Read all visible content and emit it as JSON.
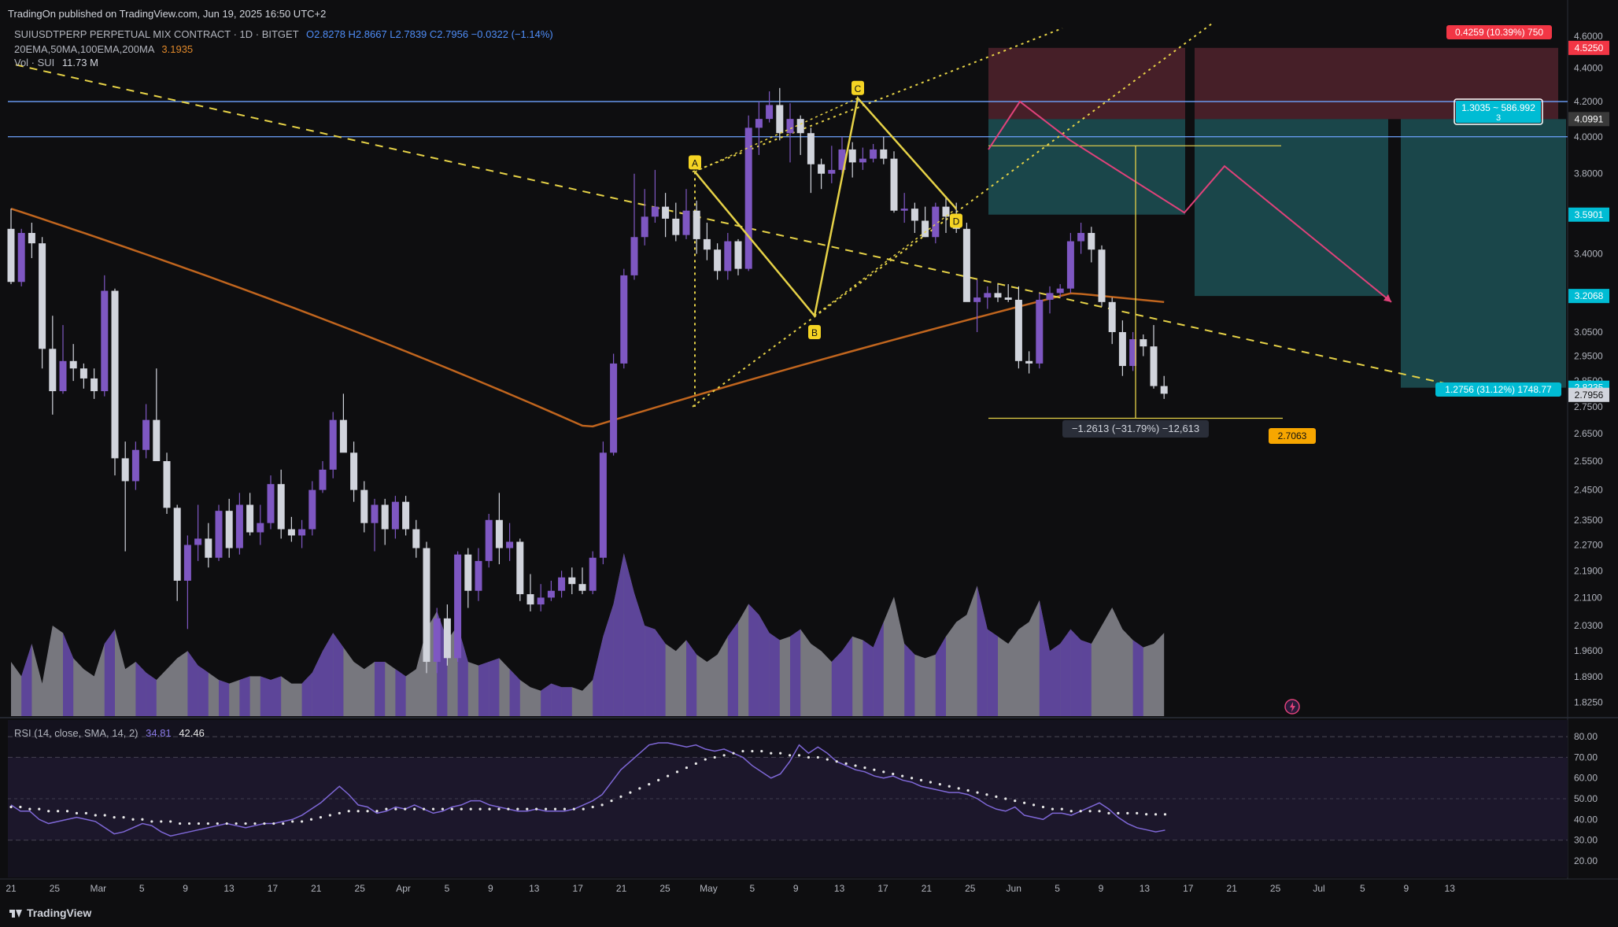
{
  "publish_line": "TradingOn published on TradingView.com, Jun 19, 2025 16:50 UTC+2",
  "legend": {
    "symbol": "SUIUSDTPERP PERPETUAL MIX CONTRACT · 1D · BITGET",
    "ohlc": "O2.8278 H2.8667 L2.7839 C2.7956 −0.0322 (−1.14%)",
    "ma_label": "20EMA,50MA,100EMA,200MA",
    "ma_value": "3.1935",
    "vol_label": "Vol · SUI",
    "vol_value": "11.73 M"
  },
  "rsi_legend": {
    "label": "RSI (14, close, SMA, 14, 2)",
    "value1": "34.81",
    "value2": "42.46"
  },
  "footer": {
    "brand": "TradingView"
  },
  "colors": {
    "bg": "#0e0e10",
    "bull": "#7e57c2",
    "bear": "#d1d4dc",
    "ma": "#c0651e",
    "rsi": "#7e67d6",
    "accent_blue": "#4f8df7"
  },
  "chart_data": {
    "type": "candlestick",
    "symbol": "SUIUSDTPERP",
    "timeframe": "1D",
    "price_scale": {
      "min": 1.75,
      "max": 4.6,
      "scale": "log",
      "ticks": [
        "4.6000",
        "4.4000",
        "4.2000",
        "4.0000",
        "3.8000",
        "3.6000",
        "3.4000",
        "3.2000",
        "3.0500",
        "2.9500",
        "2.8500",
        "2.7500",
        "2.6500",
        "2.5500",
        "2.4500",
        "2.3500",
        "2.2700",
        "2.1900",
        "2.1100",
        "2.0300",
        "1.9600",
        "1.8900",
        "1.8250"
      ]
    },
    "x_axis_labels": [
      "21",
      "25",
      "Mar",
      "5",
      "9",
      "13",
      "17",
      "21",
      "25",
      "Apr",
      "5",
      "9",
      "13",
      "17",
      "21",
      "25",
      "May",
      "5",
      "9",
      "13",
      "17",
      "21",
      "25",
      "Jun",
      "5",
      "9",
      "13",
      "17",
      "21",
      "25",
      "Jul",
      "5",
      "9",
      "13"
    ],
    "candles": [
      [
        3.52,
        3.62,
        3.26,
        3.27
      ],
      [
        3.27,
        3.52,
        3.25,
        3.5
      ],
      [
        3.5,
        3.55,
        3.38,
        3.45
      ],
      [
        3.45,
        3.48,
        2.9,
        2.98
      ],
      [
        2.98,
        3.12,
        2.72,
        2.81
      ],
      [
        2.81,
        3.08,
        2.8,
        2.93
      ],
      [
        2.93,
        3.0,
        2.85,
        2.9
      ],
      [
        2.9,
        2.92,
        2.82,
        2.86
      ],
      [
        2.86,
        2.9,
        2.78,
        2.81
      ],
      [
        2.81,
        3.3,
        2.79,
        3.23
      ],
      [
        3.23,
        3.24,
        2.5,
        2.56
      ],
      [
        2.56,
        2.62,
        2.25,
        2.48
      ],
      [
        2.48,
        2.62,
        2.45,
        2.59
      ],
      [
        2.59,
        2.76,
        2.56,
        2.7
      ],
      [
        2.7,
        2.9,
        2.58,
        2.55
      ],
      [
        2.55,
        2.58,
        2.37,
        2.39
      ],
      [
        2.39,
        2.4,
        2.1,
        2.16
      ],
      [
        2.16,
        2.3,
        2.02,
        2.27
      ],
      [
        2.27,
        2.4,
        2.22,
        2.29
      ],
      [
        2.29,
        2.34,
        2.2,
        2.23
      ],
      [
        2.23,
        2.4,
        2.22,
        2.38
      ],
      [
        2.38,
        2.42,
        2.23,
        2.26
      ],
      [
        2.26,
        2.44,
        2.24,
        2.4
      ],
      [
        2.4,
        2.44,
        2.3,
        2.31
      ],
      [
        2.31,
        2.4,
        2.27,
        2.34
      ],
      [
        2.34,
        2.5,
        2.32,
        2.47
      ],
      [
        2.47,
        2.52,
        2.29,
        2.32
      ],
      [
        2.32,
        2.36,
        2.28,
        2.3
      ],
      [
        2.3,
        2.35,
        2.26,
        2.32
      ],
      [
        2.32,
        2.48,
        2.3,
        2.45
      ],
      [
        2.45,
        2.55,
        2.44,
        2.52
      ],
      [
        2.52,
        2.73,
        2.49,
        2.7
      ],
      [
        2.7,
        2.8,
        2.62,
        2.58
      ],
      [
        2.58,
        2.62,
        2.41,
        2.45
      ],
      [
        2.45,
        2.48,
        2.31,
        2.34
      ],
      [
        2.34,
        2.42,
        2.25,
        2.4
      ],
      [
        2.4,
        2.42,
        2.27,
        2.32
      ],
      [
        2.32,
        2.43,
        2.29,
        2.41
      ],
      [
        2.41,
        2.43,
        2.3,
        2.32
      ],
      [
        2.32,
        2.35,
        2.23,
        2.26
      ],
      [
        2.26,
        2.28,
        1.9,
        1.93
      ],
      [
        1.93,
        2.08,
        1.9,
        2.05
      ],
      [
        2.05,
        2.09,
        1.92,
        1.94
      ],
      [
        1.94,
        2.25,
        1.93,
        2.24
      ],
      [
        2.24,
        2.26,
        2.08,
        2.13
      ],
      [
        2.13,
        2.26,
        2.1,
        2.22
      ],
      [
        2.22,
        2.37,
        2.2,
        2.35
      ],
      [
        2.35,
        2.44,
        2.21,
        2.26
      ],
      [
        2.26,
        2.34,
        2.22,
        2.28
      ],
      [
        2.28,
        2.29,
        2.1,
        2.12
      ],
      [
        2.12,
        2.18,
        2.07,
        2.09
      ],
      [
        2.09,
        2.15,
        2.07,
        2.11
      ],
      [
        2.11,
        2.16,
        2.1,
        2.13
      ],
      [
        2.13,
        2.19,
        2.11,
        2.17
      ],
      [
        2.17,
        2.2,
        2.12,
        2.15
      ],
      [
        2.15,
        2.2,
        2.12,
        2.13
      ],
      [
        2.13,
        2.25,
        2.12,
        2.23
      ],
      [
        2.23,
        2.62,
        2.21,
        2.58
      ],
      [
        2.58,
        2.96,
        2.57,
        2.92
      ],
      [
        2.92,
        3.33,
        2.9,
        3.3
      ],
      [
        3.3,
        3.8,
        3.28,
        3.48
      ],
      [
        3.48,
        3.72,
        3.44,
        3.58
      ],
      [
        3.58,
        3.82,
        3.55,
        3.63
      ],
      [
        3.63,
        3.7,
        3.48,
        3.57
      ],
      [
        3.57,
        3.65,
        3.46,
        3.49
      ],
      [
        3.49,
        3.72,
        3.47,
        3.61
      ],
      [
        3.61,
        3.66,
        3.4,
        3.47
      ],
      [
        3.47,
        3.55,
        3.37,
        3.42
      ],
      [
        3.42,
        3.45,
        3.28,
        3.32
      ],
      [
        3.32,
        3.5,
        3.28,
        3.46
      ],
      [
        3.46,
        3.47,
        3.3,
        3.33
      ],
      [
        3.33,
        4.12,
        3.32,
        4.05
      ],
      [
        4.05,
        4.2,
        3.9,
        4.1
      ],
      [
        4.1,
        4.26,
        4.08,
        4.18
      ],
      [
        4.18,
        4.28,
        3.98,
        4.02
      ],
      [
        4.02,
        4.19,
        3.86,
        4.1
      ],
      [
        4.1,
        4.12,
        3.9,
        4.02
      ],
      [
        4.02,
        4.05,
        3.7,
        3.85
      ],
      [
        3.85,
        3.88,
        3.72,
        3.8
      ],
      [
        3.8,
        3.95,
        3.75,
        3.82
      ],
      [
        3.82,
        4.0,
        3.8,
        3.93
      ],
      [
        3.93,
        3.97,
        3.78,
        3.86
      ],
      [
        3.86,
        3.94,
        3.82,
        3.88
      ],
      [
        3.88,
        3.96,
        3.86,
        3.93
      ],
      [
        3.93,
        4.0,
        3.85,
        3.88
      ],
      [
        3.88,
        3.92,
        3.6,
        3.61
      ],
      [
        3.61,
        3.7,
        3.55,
        3.62
      ],
      [
        3.62,
        3.65,
        3.5,
        3.56
      ],
      [
        3.56,
        3.63,
        3.48,
        3.48
      ],
      [
        3.48,
        3.65,
        3.45,
        3.63
      ],
      [
        3.63,
        3.68,
        3.5,
        3.58
      ],
      [
        3.58,
        3.65,
        3.5,
        3.52
      ],
      [
        3.52,
        3.55,
        3.2,
        3.18
      ],
      [
        3.18,
        3.28,
        3.05,
        3.2
      ],
      [
        3.2,
        3.25,
        3.15,
        3.22
      ],
      [
        3.22,
        3.26,
        3.18,
        3.2
      ],
      [
        3.2,
        3.26,
        3.18,
        3.19
      ],
      [
        3.19,
        3.25,
        2.9,
        2.93
      ],
      [
        2.93,
        2.97,
        2.88,
        2.92
      ],
      [
        2.92,
        3.22,
        2.9,
        3.19
      ],
      [
        3.19,
        3.25,
        3.13,
        3.22
      ],
      [
        3.22,
        3.26,
        3.2,
        3.24
      ],
      [
        3.24,
        3.5,
        3.22,
        3.46
      ],
      [
        3.46,
        3.55,
        3.4,
        3.5
      ],
      [
        3.5,
        3.53,
        3.36,
        3.42
      ],
      [
        3.42,
        3.44,
        3.16,
        3.18
      ],
      [
        3.18,
        3.2,
        3.0,
        3.05
      ],
      [
        3.05,
        3.1,
        2.87,
        2.91
      ],
      [
        2.91,
        3.05,
        2.89,
        3.02
      ],
      [
        3.02,
        3.04,
        2.95,
        2.99
      ],
      [
        2.99,
        3.08,
        2.82,
        2.83
      ],
      [
        2.83,
        2.87,
        2.78,
        2.8
      ]
    ],
    "volume_label": "Vol · SUI",
    "series": [
      {
        "name": "20EMA,50MA,100EMA,200MA",
        "type": "line",
        "last": 3.1935
      }
    ],
    "price_labels": [
      {
        "text": "4.5250",
        "color": "#f23645"
      },
      {
        "text": "4.0991",
        "color": "#3a3a3a"
      },
      {
        "text": "3.5901",
        "color": "#00bcd4"
      },
      {
        "text": "3.2068",
        "color": "#00bcd4"
      },
      {
        "text": "2.8235",
        "color": "#00bcd4"
      },
      {
        "text": "2.7956",
        "color": "#d1d4dc"
      }
    ],
    "annotations": [
      {
        "text": "0.4259 (10.39%) 750",
        "color": "#f23645"
      },
      {
        "text": "1.3035 ~ 586.992",
        "sub": "3",
        "color": "#00bcd4"
      },
      {
        "text": "1.2756 (31.12%) 1748.77",
        "color": "#00bcd4"
      },
      {
        "text": "−1.2613 (−31.79%) −12,613",
        "color": "#2a2e39"
      },
      {
        "text": "2.7063",
        "color": "#f7a600"
      }
    ],
    "pattern_points": [
      "A",
      "B",
      "C",
      "D"
    ],
    "rsi": {
      "label": "RSI (14, close, SMA, 14, 2)",
      "value": 34.81,
      "sma": 42.46,
      "range": [
        20,
        80
      ],
      "ticks": [
        "80.00",
        "70.00",
        "60.00",
        "50.00",
        "40.00",
        "30.00",
        "20.00"
      ],
      "values": [
        47,
        44,
        44,
        40,
        38,
        39,
        40,
        41,
        40,
        39,
        36,
        33,
        34,
        36,
        38,
        37,
        34,
        32,
        33,
        34,
        35,
        36,
        37,
        38,
        37,
        36,
        37,
        38,
        38,
        39,
        40,
        42,
        45,
        48,
        52,
        56,
        52,
        47,
        46,
        43,
        44,
        46,
        45,
        47,
        45,
        43,
        44,
        46,
        47,
        49,
        49,
        47,
        46,
        45,
        44,
        44,
        45,
        44,
        44,
        44,
        45,
        47,
        49,
        52,
        58,
        64,
        68,
        72,
        76,
        77,
        77,
        76,
        75,
        76,
        74,
        73,
        74,
        72,
        70,
        66,
        63,
        60,
        62,
        68,
        76,
        72,
        75,
        72,
        68,
        66,
        64,
        63,
        61,
        60,
        61,
        59,
        58,
        56,
        55,
        54,
        53,
        53,
        52,
        50,
        47,
        45,
        44,
        46,
        42,
        41,
        40,
        43,
        43,
        42,
        44,
        46,
        48,
        45,
        41,
        38,
        36,
        35,
        34,
        34.81
      ],
      "sma_values": [
        46,
        46,
        45,
        45,
        44,
        44,
        44,
        43,
        43,
        42,
        42,
        41,
        41,
        40,
        40,
        39,
        39,
        39,
        38,
        38,
        38,
        38,
        38,
        38,
        38,
        38,
        38,
        38,
        38,
        38,
        39,
        39,
        40,
        41,
        42,
        43,
        44,
        44,
        44,
        44,
        45,
        45,
        45,
        45,
        45,
        45,
        45,
        45,
        45,
        45,
        45,
        45,
        45,
        45,
        45,
        45,
        45,
        45,
        45,
        45,
        45,
        45,
        46,
        47,
        49,
        51,
        53,
        55,
        57,
        59,
        61,
        63,
        65,
        67,
        69,
        70,
        71,
        72,
        73,
        73,
        73,
        72,
        72,
        71,
        71,
        70,
        70,
        69,
        68,
        67,
        66,
        65,
        64,
        63,
        62,
        61,
        60,
        59,
        58,
        57,
        56,
        55,
        54,
        53,
        52,
        51,
        50,
        49,
        48,
        47,
        46,
        45,
        45,
        44,
        44,
        44,
        44,
        43,
        43,
        43,
        43,
        42.5,
        42.46,
        42.46
      ]
    }
  }
}
